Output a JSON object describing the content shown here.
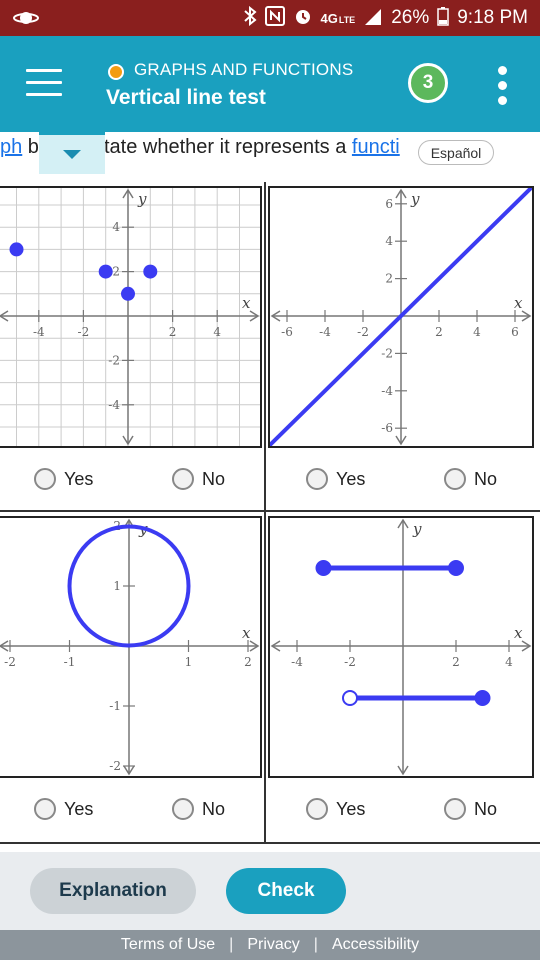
{
  "status_bar": {
    "battery": "26%",
    "time": "9:18 PM",
    "network": "4G",
    "network_sub": "LTE"
  },
  "header": {
    "topic": "GRAPHS AND FUNCTIONS",
    "title": "Vertical line test",
    "score": "3",
    "topic_dot_color": "#f39c12",
    "accent_color": "#1aa0bf"
  },
  "instruction": {
    "lead_link": "ph",
    "lead_after": " b",
    "text_before": "tate whether it represents a ",
    "text_link": "functi"
  },
  "language_button": "Español",
  "graphs": [
    {
      "id": "graph-1",
      "x_label": "x",
      "y_label": "y",
      "x_ticks": [
        "-4",
        "-2",
        "2",
        "4"
      ],
      "y_ticks": [
        "4",
        "2",
        "-2",
        "-4"
      ],
      "points": [
        [
          -5,
          3
        ],
        [
          -1,
          2
        ],
        [
          1,
          2
        ],
        [
          0,
          1
        ]
      ],
      "answer": {
        "yes": "Yes",
        "no": "No"
      }
    },
    {
      "id": "graph-2",
      "x_label": "x",
      "y_label": "y",
      "x_ticks": [
        "-6",
        "-4",
        "-2",
        "2",
        "4",
        "6"
      ],
      "y_ticks": [
        "6",
        "4",
        "2",
        "-2",
        "-4",
        "-6"
      ],
      "line": [
        [
          -7,
          -7
        ],
        [
          7,
          7
        ]
      ],
      "answer": {
        "yes": "Yes",
        "no": "No"
      }
    },
    {
      "id": "graph-3",
      "x_label": "x",
      "y_label": "y",
      "x_ticks": [
        "-2",
        "-1",
        "1",
        "2"
      ],
      "y_ticks": [
        "2",
        "1",
        "-1",
        "-2"
      ],
      "circle": {
        "cx": 0,
        "cy": 1,
        "r": 1
      },
      "answer": {
        "yes": "Yes",
        "no": "No"
      }
    },
    {
      "id": "graph-4",
      "x_label": "x",
      "y_label": "y",
      "x_ticks": [
        "-4",
        "-2",
        "2",
        "4"
      ],
      "segments": [
        {
          "from": [
            -3,
            3
          ],
          "to": [
            2,
            3
          ],
          "from_open": false,
          "to_open": false
        },
        {
          "from": [
            -2,
            -2
          ],
          "to": [
            3,
            -2
          ],
          "from_open": true,
          "to_open": false
        }
      ],
      "answer": {
        "yes": "Yes",
        "no": "No"
      }
    }
  ],
  "actions": {
    "explanation": "Explanation",
    "check": "Check"
  },
  "footer": {
    "terms": "Terms of Use",
    "privacy": "Privacy",
    "accessibility": "Accessibility",
    "separator": "|"
  }
}
